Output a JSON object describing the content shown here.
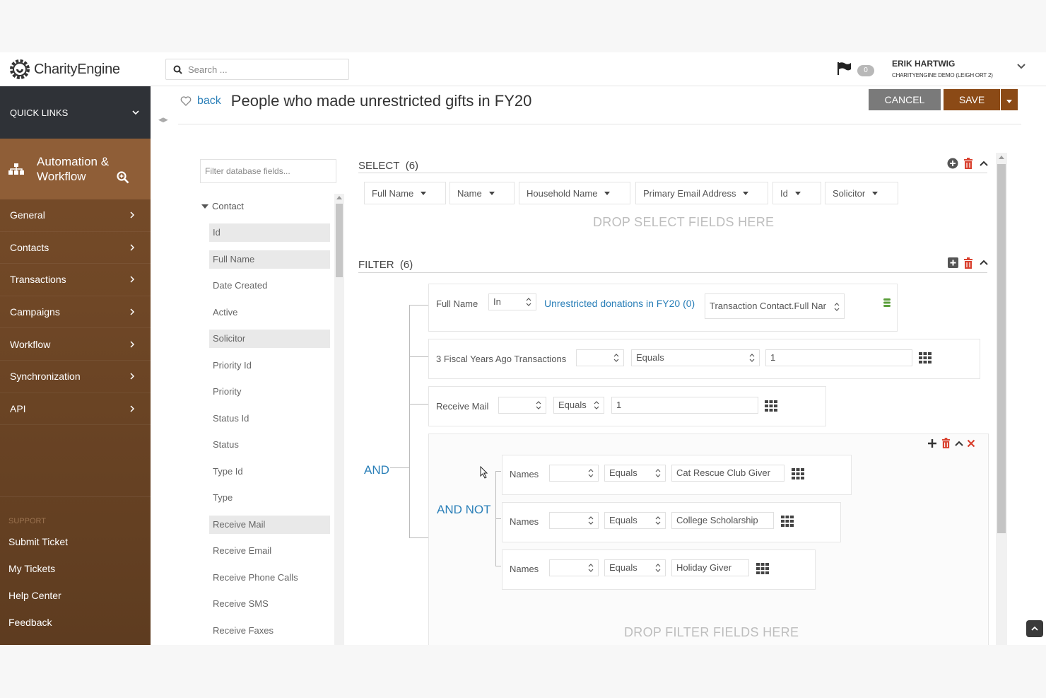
{
  "header": {
    "brand": "CharityEngine",
    "search_placeholder": "Search ...",
    "notification_count": "0",
    "user_name": "ERIK HARTWIG",
    "user_org": "CHARITYENGINE DEMO (LEIGH ORT 2)"
  },
  "sidebar": {
    "quick_links": "QUICK LINKS",
    "automation_line1": "Automation &",
    "automation_line2": "Workflow",
    "items": [
      "General",
      "Contacts",
      "Transactions",
      "Campaigns",
      "Workflow",
      "Synchronization",
      "API"
    ],
    "support_heading": "SUPPORT",
    "support_items": [
      "Submit Ticket",
      "My Tickets",
      "Help Center",
      "Feedback"
    ]
  },
  "page": {
    "back": "back",
    "title": "People who made unrestricted gifts in FY20",
    "cancel": "CANCEL",
    "save": "SAVE"
  },
  "fields_panel": {
    "filter_placeholder": "Filter database fields...",
    "group": "Contact",
    "fields": [
      "Id",
      "Full Name",
      "Date Created",
      "Active",
      "Solicitor",
      "Priority Id",
      "Priority",
      "Status Id",
      "Status",
      "Type Id",
      "Type",
      "Receive Mail",
      "Receive Email",
      "Receive Phone Calls",
      "Receive SMS",
      "Receive Faxes"
    ],
    "highlighted": [
      0,
      1,
      4,
      11
    ]
  },
  "select_section": {
    "title": "SELECT",
    "count": "(6)",
    "chips": [
      "Full Name",
      "Name",
      "Household Name",
      "Primary Email Address",
      "Id",
      "Solicitor"
    ],
    "drop_text": "DROP SELECT FIELDS HERE"
  },
  "filter_section": {
    "title": "FILTER",
    "count": "(6)",
    "and_label": "AND",
    "and_not_label": "AND NOT",
    "row1": {
      "field": "Full Name",
      "operator": "In",
      "link": "Unrestricted donations in FY20 (0)",
      "target": "Transaction Contact.Full Nar"
    },
    "row2": {
      "field": "3 Fiscal Years Ago Transactions",
      "operator": "Equals",
      "value": "1"
    },
    "row3": {
      "field": "Receive Mail",
      "operator": "Equals",
      "value": "1"
    },
    "group_rows": [
      {
        "field": "Names",
        "operator": "Equals",
        "value": "Cat Rescue Club Giver"
      },
      {
        "field": "Names",
        "operator": "Equals",
        "value": "College Scholarship"
      },
      {
        "field": "Names",
        "operator": "Equals",
        "value": "Holiday Giver"
      }
    ],
    "drop_text": "DROP FILTER FIELDS HERE"
  },
  "colors": {
    "sidebar_brown": "#7a4e2a",
    "accent_blue": "#2a7fb8",
    "save_brown": "#8b4a16",
    "delete_red": "#d9412f"
  }
}
